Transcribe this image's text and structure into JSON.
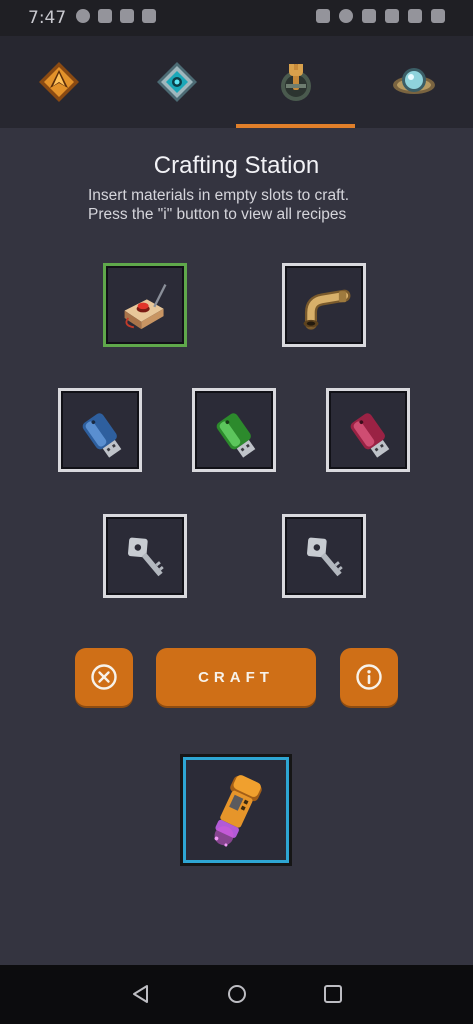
{
  "status_bar": {
    "time": "7:47"
  },
  "tabs": [
    {
      "id": "tab-1",
      "icon": "orange-arrow-emblem-icon"
    },
    {
      "id": "tab-2",
      "icon": "cyan-gem-emblem-icon"
    },
    {
      "id": "tab-3",
      "icon": "crafting-wrench-emblem-icon",
      "active": true
    },
    {
      "id": "tab-4",
      "icon": "planet-orb-icon"
    }
  ],
  "header": {
    "title": "Crafting Station",
    "subtitle_line1": "Insert materials in empty slots to craft.",
    "subtitle_line2": "Press the \"i\" button to view all recipes"
  },
  "slots": [
    {
      "item": "detonator-box",
      "selected": true
    },
    {
      "item": "brass-pipe"
    },
    {
      "item": "blue-usb-drive"
    },
    {
      "item": "green-usb-drive"
    },
    {
      "item": "red-usb-drive"
    },
    {
      "item": "silver-key"
    },
    {
      "item": "silver-key"
    }
  ],
  "actions": {
    "clear_icon": "close-circle-icon",
    "craft_label": "CRAFT",
    "info_icon": "info-circle-icon"
  },
  "result": {
    "item": "orange-energy-cell"
  },
  "colors": {
    "accent": "#cf6f17",
    "background": "#343440",
    "selected_border": "#5fa84b",
    "result_border": "#2ea6d3"
  }
}
